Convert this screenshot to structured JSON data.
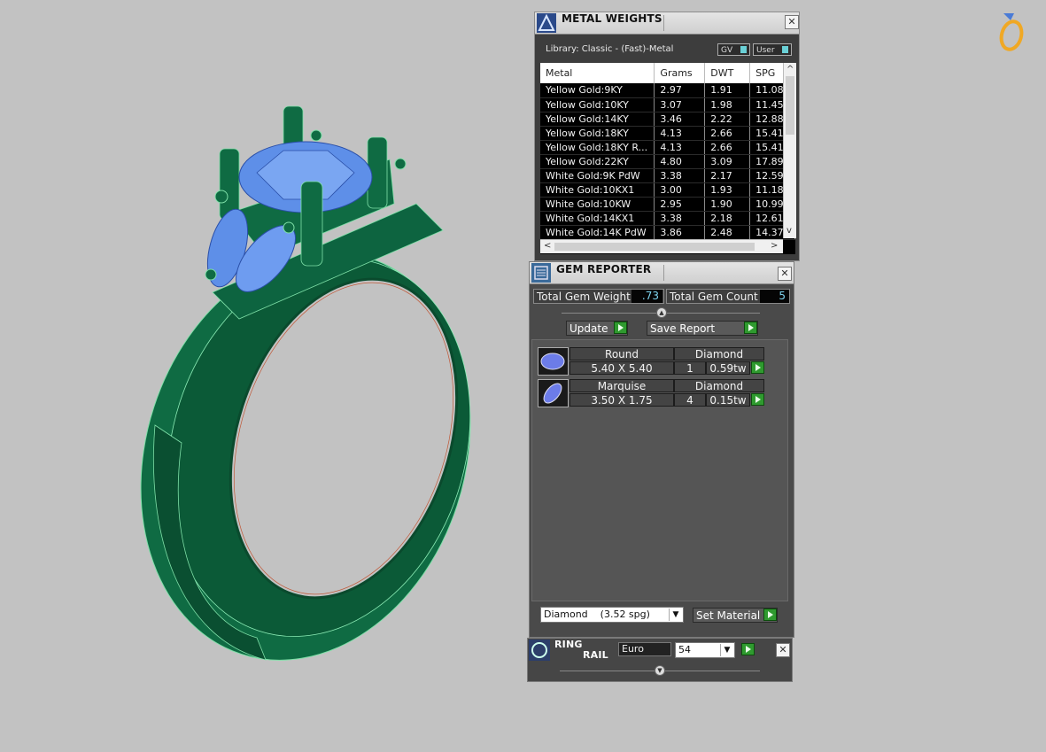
{
  "metal_weights": {
    "title": "METAL WEIGHTS",
    "library": "Library: Classic - (Fast)-Metal",
    "gv_label": "GV",
    "user_label": "User",
    "columns": [
      "Metal",
      "Grams",
      "DWT",
      "SPG"
    ],
    "rows": [
      [
        "Yellow Gold:9KY",
        "2.97",
        "1.91",
        "11.08"
      ],
      [
        "Yellow Gold:10KY",
        "3.07",
        "1.98",
        "11.45"
      ],
      [
        "Yellow Gold:14KY",
        "3.46",
        "2.22",
        "12.88"
      ],
      [
        "Yellow Gold:18KY",
        "4.13",
        "2.66",
        "15.41"
      ],
      [
        "Yellow Gold:18KY R...",
        "4.13",
        "2.66",
        "15.41"
      ],
      [
        "Yellow Gold:22KY",
        "4.80",
        "3.09",
        "17.89"
      ],
      [
        "White Gold:9K PdW",
        "3.38",
        "2.17",
        "12.59"
      ],
      [
        "White Gold:10KX1",
        "3.00",
        "1.93",
        "11.18"
      ],
      [
        "White Gold:10KW",
        "2.95",
        "1.90",
        "10.99"
      ],
      [
        "White Gold:14KX1",
        "3.38",
        "2.18",
        "12.61"
      ],
      [
        "White Gold:14K PdW",
        "3.86",
        "2.48",
        "14.37"
      ]
    ]
  },
  "gem_reporter": {
    "title": "GEM REPORTER",
    "total_weight_label": "Total Gem Weight",
    "total_weight": ".73",
    "total_count_label": "Total Gem Count",
    "total_count": "5",
    "update_label": "Update",
    "save_report_label": "Save Report",
    "gems": [
      {
        "shape": "Round",
        "material": "Diamond",
        "size": "5.40 X 5.40",
        "count": "1",
        "weight": "0.59tw"
      },
      {
        "shape": "Marquise",
        "material": "Diamond",
        "size": "3.50 X 1.75",
        "count": "4",
        "weight": "0.15tw"
      }
    ],
    "material_select": "Diamond    (3.52 spg)",
    "set_material_label": "Set Material"
  },
  "ring_rail": {
    "title_line1": "RING",
    "title_line2": "RAIL",
    "standard": "Euro",
    "size": "54"
  },
  "colors": {
    "ring_green": "#0f6b43",
    "gem_blue": "#5e8fe8",
    "panel_dark": "#4a4a4a",
    "go_green": "#2f9a2f"
  }
}
